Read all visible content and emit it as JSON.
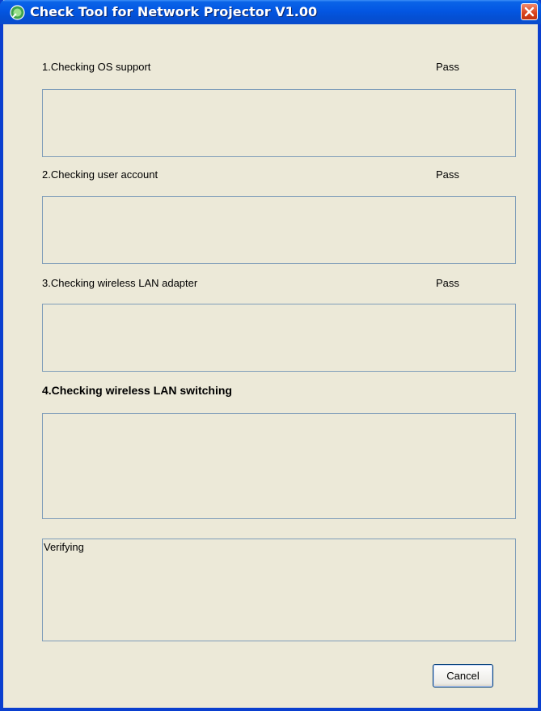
{
  "window": {
    "title": "Check Tool for Network Projector V1.00"
  },
  "checks": [
    {
      "label": "1.Checking OS support",
      "status": "Pass"
    },
    {
      "label": "2.Checking user account",
      "status": "Pass"
    },
    {
      "label": "3.Checking wireless LAN adapter",
      "status": "Pass"
    },
    {
      "label": "4.Checking wireless LAN switching",
      "status": ""
    }
  ],
  "log": {
    "text": "Verifying"
  },
  "buttons": {
    "cancel": "Cancel"
  },
  "icons": {
    "app": "network-projector-icon",
    "close": "close-icon"
  },
  "colors": {
    "titlebar": "#0356e2",
    "dialog_bg": "#ece9d8",
    "close": "#d9421c",
    "box_border": "#7f9db9"
  }
}
